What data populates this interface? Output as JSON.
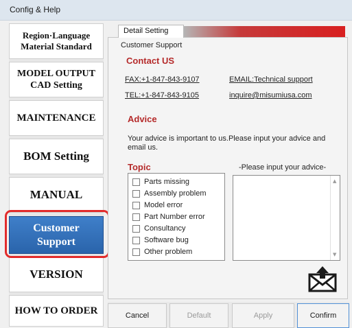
{
  "window": {
    "title": "Config & Help"
  },
  "sidebar": {
    "region_language": "Region·Language",
    "material_standard": "Material Standard",
    "model_output": "MODEL OUTPUT",
    "cad_setting": "CAD Setting",
    "maintenance": "MAINTENANCE",
    "bom_setting": "BOM Setting",
    "manual": "MANUAL",
    "customer": "Customer",
    "support": "Support",
    "version": "VERSION",
    "how_to_order": "HOW TO ORDER"
  },
  "tab": {
    "label": "Detail Setting"
  },
  "panel": {
    "section": "Customer Support",
    "contact_heading": "Contact US",
    "fax": "FAX:+1-847-843-9107",
    "email": "EMAIL:Technical support",
    "tel": "TEL:+1-847-843-9105",
    "inquire": "inquire@misumiusa.com",
    "advice_heading": "Advice",
    "advice_text_1": "Your advice is important to us.Please input your advice and",
    "advice_text_2": "email us.",
    "topic_heading": "Topic",
    "advice_input_label": "-Please input your advice-",
    "topics": [
      "Parts missing",
      "Assembly problem",
      "Model error",
      "Part Number error",
      "Consultancy",
      "Software bug",
      "Other problem"
    ],
    "advice_value": ""
  },
  "footer": {
    "cancel": "Cancel",
    "default": "Default",
    "apply": "Apply",
    "confirm": "Confirm"
  },
  "colors": {
    "accent_red": "#b52a2a",
    "active_blue": "#2a64ab",
    "highlight_red": "#e22b2b"
  }
}
